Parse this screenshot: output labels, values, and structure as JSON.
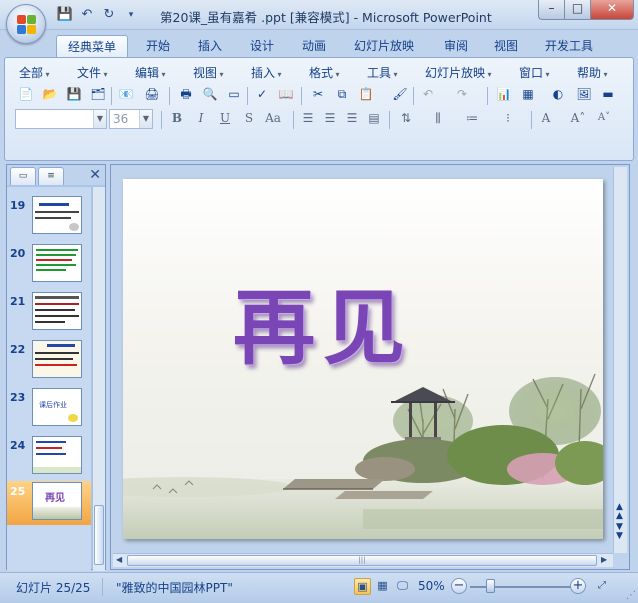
{
  "window": {
    "title": "第20课_虽有嘉肴 .ppt [兼容模式] - Microsoft PowerPoint",
    "minimize_glyph": "–",
    "maximize_glyph": "□",
    "close_glyph": "✕"
  },
  "ribbon_tabs": [
    "经典菜单",
    "开始",
    "插入",
    "设计",
    "动画",
    "幻灯片放映",
    "审阅",
    "视图",
    "开发工具"
  ],
  "classic_menu": [
    "全部",
    "文件",
    "编辑",
    "视图",
    "插入",
    "格式",
    "工具",
    "幻灯片放映",
    "窗口",
    "帮助"
  ],
  "font_combo": {
    "name": "",
    "size": "36"
  },
  "format_buttons": [
    "B",
    "I",
    "U",
    "S",
    "Aa"
  ],
  "slides_panel": {
    "tabs": [
      "▭",
      "≡"
    ],
    "close_glyph": "✕",
    "thumbnails": [
      {
        "num": "19"
      },
      {
        "num": "20"
      },
      {
        "num": "21"
      },
      {
        "num": "22"
      },
      {
        "num": "23",
        "text": "课后作业"
      },
      {
        "num": "24"
      },
      {
        "num": "25",
        "text": "再见",
        "active": true
      }
    ]
  },
  "slide": {
    "title": "再见"
  },
  "statusbar": {
    "slide_info": "幻灯片 25/25",
    "theme": "\"雅致的中国园林PPT\"",
    "zoom": "50%",
    "zoom_level_percent": 50
  },
  "colors": {
    "ribbon_blue": "#bfd3ec",
    "title_purple": "#7a45b5",
    "active_thumb": "#f2a543"
  }
}
